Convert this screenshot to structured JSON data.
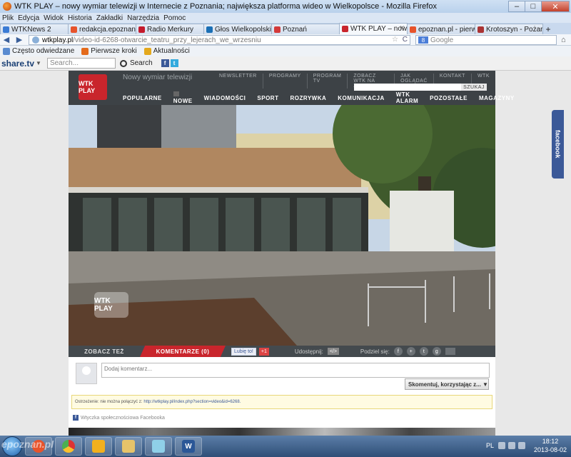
{
  "window": {
    "title": "WTK PLAY – nowy wymiar telewizji w Internecie z Poznania; największa platforma wideo w Wielkopolsce - Mozilla Firefox",
    "minimize": "–",
    "maximize": "□",
    "close": "✕"
  },
  "menubar": [
    "Plik",
    "Edycja",
    "Widok",
    "Historia",
    "Zakładki",
    "Narzędzia",
    "Pomoc"
  ],
  "tabs": [
    {
      "label": "WTKNews 2",
      "color": "#3a7bd5"
    },
    {
      "label": "redakcja.epoznan.pl",
      "color": "#e7532b"
    },
    {
      "label": "Radio Merkury",
      "color": "#c41a2c"
    },
    {
      "label": "Głos Wielkopolski - ...",
      "color": "#1a6fb5"
    },
    {
      "label": "Poznań",
      "color": "#d33a3a"
    },
    {
      "label": "WTK PLAY – nowy ...",
      "color": "#c9252c",
      "active": true
    },
    {
      "label": "epoznan.pl - pierws...",
      "color": "#e7532b"
    },
    {
      "label": "Krotoszyn - Pożar w...",
      "color": "#a33"
    }
  ],
  "navbar": {
    "back": "◀",
    "forward": "▶",
    "url_host": "wtkplay.pl",
    "url_path": "/video-id-6268-otwarcie_teatru_przy_lejerach_we_wrzesniu",
    "star": "☆",
    "reload": "C",
    "search_engine": "8",
    "search_placeholder": "Google",
    "home": "⌂"
  },
  "bookmarks": [
    {
      "label": "Często odwiedzane",
      "color": "#5a8bd0"
    },
    {
      "label": "Pierwsze kroki",
      "color": "#e46b1c"
    },
    {
      "label": "Aktualności",
      "color": "#e4a81c"
    }
  ],
  "sharebar": {
    "logo": "share.tv",
    "dropdown": "▼",
    "search_placeholder": "Search...",
    "search_button": "Search",
    "social": [
      {
        "label": "f",
        "color": "#3b5998"
      },
      {
        "label": "t",
        "color": "#33aadd"
      }
    ]
  },
  "site": {
    "logo": "WTK PLAY",
    "tagline": "Nowy wymiar telewizji",
    "topnav": [
      "NEWSLETTER",
      "PROGRAMY",
      "PROGRAM TV",
      "ZOBACZ WTK NA ŻYWO",
      "JAK OGLĄDAĆ",
      "KONTAKT",
      "WTK"
    ],
    "search_button": "SZUKAJ",
    "mainnav": [
      "POPULARNE",
      "NOWE",
      "WIADOMOŚCI",
      "SPORT",
      "ROZRYWKA",
      "KOMUNIKACJA",
      "WTK ALARM",
      "POZOSTAŁE",
      "MAGAZYNY"
    ],
    "video_watermark": "WTK PLAY",
    "facebook_tab": "facebook"
  },
  "below_video": {
    "see_also": "ZOBACZ TEŻ",
    "comments": "KOMENTARZE (0)",
    "like": "Lubię to!",
    "gplus": "+1",
    "share_label": "Udostępnij:",
    "embed": "</>",
    "share_on": "Podziel się:",
    "share_icons": [
      "f",
      "+",
      "t",
      "g"
    ]
  },
  "comments": {
    "placeholder": "Dodaj komentarz...",
    "post_as": "Skomentuj, korzystając z... ▼",
    "warning_text": "Ostrzeżenie: nie można połączyć z:",
    "warning_link": "http://wtkplay.pl/index.php?section=video&id=6268.",
    "plugin_label": "Wtyczka społecznościowa Facebooka"
  },
  "taskbar": {
    "apps": [
      {
        "name": "firefox",
        "color": "#e7532b"
      },
      {
        "name": "chrome",
        "color": "#4caf50"
      },
      {
        "name": "windows-security",
        "color": "#f2b01e"
      },
      {
        "name": "file-explorer",
        "color": "#e6c36a"
      },
      {
        "name": "notepad",
        "color": "#8fd0e8"
      },
      {
        "name": "word",
        "color": "#2b5797",
        "label": "W"
      }
    ],
    "watermark": "epoznan.pl",
    "lang": "PL",
    "time": "18:12",
    "date": "2013-08-02"
  }
}
